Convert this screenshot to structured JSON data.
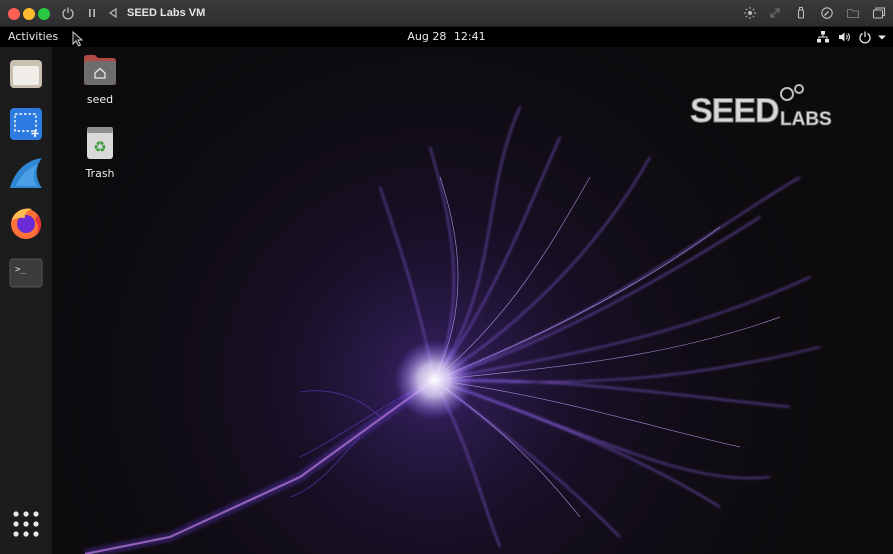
{
  "vm_window": {
    "title": "SEED Labs VM"
  },
  "top_bar": {
    "activities_label": "Activities",
    "date": "Aug 28",
    "time": "12:41"
  },
  "dock": {
    "items": [
      {
        "name": "files",
        "icon": "folder-icon"
      },
      {
        "name": "screenshot",
        "icon": "screenshot-icon"
      },
      {
        "name": "wireshark",
        "icon": "wireshark-fin-icon"
      },
      {
        "name": "firefox",
        "icon": "firefox-icon"
      },
      {
        "name": "terminal",
        "icon": "terminal-icon",
        "prompt": ">_"
      }
    ],
    "show_apps_icon": "app-grid-icon"
  },
  "desktop": {
    "icons": [
      {
        "label": "seed",
        "icon": "home-folder-icon"
      },
      {
        "label": "Trash",
        "icon": "trash-icon"
      }
    ],
    "logo_text": "SEED LABS"
  },
  "colors": {
    "titlebar": "#2e2e30",
    "accent_purple": "#8a5cff",
    "dock_bg": "#1c1c1c"
  }
}
